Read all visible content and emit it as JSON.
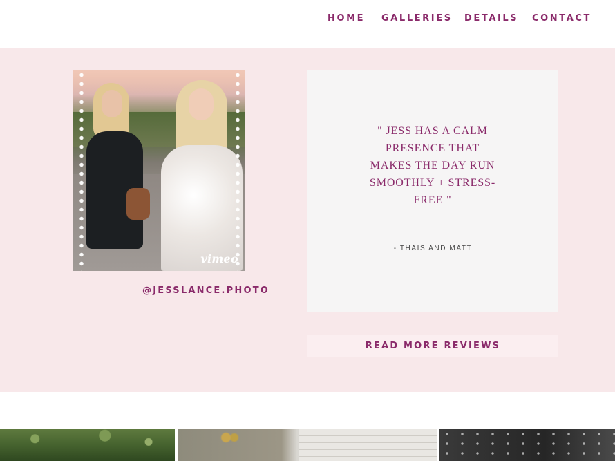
{
  "nav": {
    "items": [
      {
        "label": "HOME"
      },
      {
        "label": "GALLERIES"
      },
      {
        "label": "DETAILS"
      },
      {
        "label": "CONTACT"
      }
    ]
  },
  "video": {
    "provider_label": "vimeo"
  },
  "social": {
    "handle": "@JESSLANCE.PHOTO"
  },
  "testimonial": {
    "quote": "\" JESS HAS A CALM PRESENCE THAT MAKES THE DAY RUN SMOOTHLY + STRESS-FREE \"",
    "author": "- THAIS AND MATT"
  },
  "reviews": {
    "button_label": "READ MORE REVIEWS"
  },
  "colors": {
    "accent": "#8a2a6a",
    "band_background": "#f8e8ea",
    "card_background": "#f6f5f5"
  }
}
